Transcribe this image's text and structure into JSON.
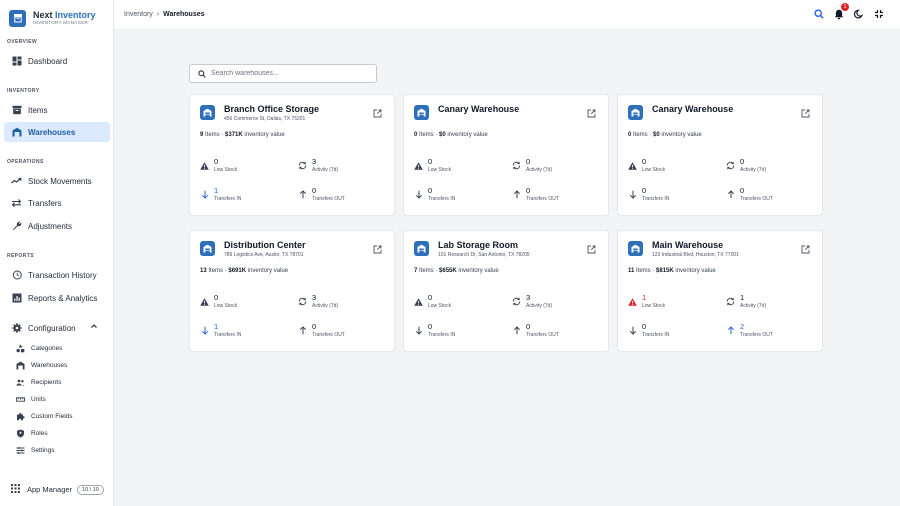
{
  "brand": {
    "title_main": "Next",
    "title_accent": "Inventory",
    "subtitle": "INVENTORY MANAGER"
  },
  "sidebar": {
    "sections": {
      "overview": "OVERVIEW",
      "inventory": "INVENTORY",
      "operations": "OPERATIONS",
      "reports": "REPORTS"
    },
    "items": {
      "dashboard": "Dashboard",
      "items": "Items",
      "warehouses": "Warehouses",
      "stock_movements": "Stock Movements",
      "transfers": "Transfers",
      "adjustments": "Adjustments",
      "transaction_history": "Transaction History",
      "reports_analytics": "Reports & Analytics",
      "configuration": "Configuration"
    },
    "config_items": [
      "Categories",
      "Warehouses",
      "Recipients",
      "Units",
      "Custom Fields",
      "Roles",
      "Settings"
    ],
    "app_manager": {
      "label": "App Manager",
      "badge": "10 / 10"
    }
  },
  "header": {
    "breadcrumb_root": "Inventory",
    "breadcrumb_sep": "›",
    "breadcrumb_current": "Warehouses",
    "notification_count": "1"
  },
  "search": {
    "placeholder": "Search warehouses..."
  },
  "labels": {
    "items_suffix": "Items",
    "inventory_value_suffix": "inventory value",
    "low_stock": "Low Stock",
    "activity": "Activity (7d)",
    "transfers_in": "Transfers IN",
    "transfers_out": "Transfers OUT"
  },
  "warehouses": [
    {
      "name": "Branch Office Storage",
      "address": "456 Commerce St, Dallas, TX 75201",
      "items": "9",
      "value": "$371K",
      "low_stock": "0",
      "activity": "3",
      "transfers_in": "1",
      "transfers_out": "0"
    },
    {
      "name": "Canary Warehouse",
      "address": "",
      "items": "0",
      "value": "$0",
      "low_stock": "0",
      "activity": "0",
      "transfers_in": "0",
      "transfers_out": "0"
    },
    {
      "name": "Canary Warehouse",
      "address": "",
      "items": "0",
      "value": "$0",
      "low_stock": "0",
      "activity": "0",
      "transfers_in": "0",
      "transfers_out": "0"
    },
    {
      "name": "Distribution Center",
      "address": "789 Logistics Ave, Austin, TX 78701",
      "items": "13",
      "value": "$691K",
      "low_stock": "0",
      "activity": "3",
      "transfers_in": "1",
      "transfers_out": "0"
    },
    {
      "name": "Lab Storage Room",
      "address": "101 Research Dr, San Antonio, TX 78205",
      "items": "7",
      "value": "$655K",
      "low_stock": "0",
      "activity": "3",
      "transfers_in": "0",
      "transfers_out": "0"
    },
    {
      "name": "Main Warehouse",
      "address": "123 Industrial Blvd, Houston, TX 77001",
      "items": "11",
      "value": "$815K",
      "low_stock": "1",
      "activity": "1",
      "transfers_in": "0",
      "transfers_out": "2"
    }
  ],
  "colors": {
    "accent": "#2d6fb8",
    "active_bg": "#dbeafe",
    "alert": "#dc2626",
    "link_blue": "#2563eb"
  }
}
